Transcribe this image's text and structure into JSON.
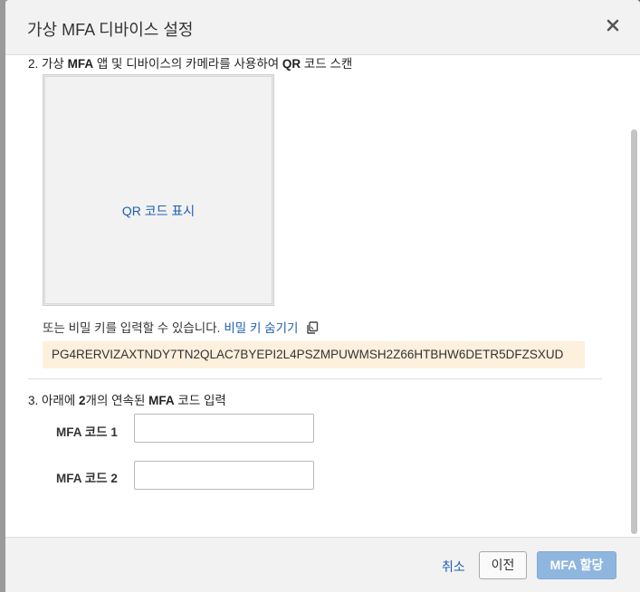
{
  "dialog": {
    "title": "가상 MFA 디바이스 설정"
  },
  "step2": {
    "prefix": "2. 가상 ",
    "mfa": "MFA",
    "middle": " 앱 및 디바이스의 카메라를 사용하여 ",
    "qr": "QR",
    "suffix": " 코드 스캔",
    "qr_link": "QR 코드 표시"
  },
  "secret": {
    "text": "또는 비밀 키를 입력할 수 있습니다.",
    "hide_link": "비밀 키 숨기기",
    "key": "PG4RERVIZAXTNDY7TN2QLAC7BYEPI2L4PSZMPUWMSH2Z66HTBHW6DETR5DFZSXUD"
  },
  "step3": {
    "prefix": "3. 아래에 ",
    "count": "2",
    "middle": "개의 연속된 ",
    "mfa": "MFA",
    "suffix": " 코드 입력",
    "fields": [
      {
        "label": "MFA 코드 1",
        "value": ""
      },
      {
        "label": "MFA 코드 2",
        "value": ""
      }
    ]
  },
  "footer": {
    "cancel": "취소",
    "previous": "이전",
    "assign": "MFA 할당"
  },
  "icons": {
    "close": "close-icon",
    "copy": "copy-icon"
  },
  "colors": {
    "link": "#1f5fb0",
    "key_background": "#fdf0dd",
    "primary_disabled": "#8fb6de"
  }
}
